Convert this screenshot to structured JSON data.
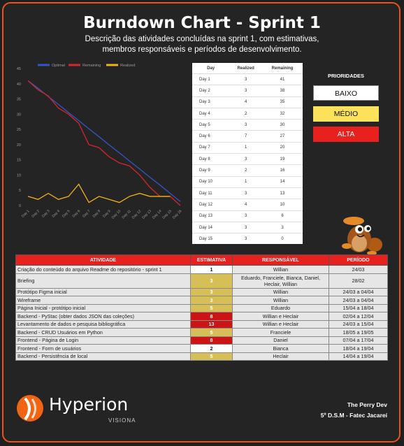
{
  "title": "Burndown Chart - Sprint 1",
  "subtitle_line1": "Descrição das atividades concluídas na sprint 1, com estimativas,",
  "subtitle_line2": "membros responsáveis e períodos de desenvolvimento.",
  "colors": {
    "accent": "#e8541b",
    "optimal": "#3356c6",
    "remaining": "#d7262b",
    "realized": "#f2b21b",
    "priority_low": "#ffffff",
    "priority_mid": "#fbe25a",
    "priority_high": "#e8201e"
  },
  "chart_data": {
    "type": "line",
    "x": [
      "Day 1",
      "Day 2",
      "Day 3",
      "Day 4",
      "Day 5",
      "Day 6",
      "Day 7",
      "Day 8",
      "Day 9",
      "Day 10",
      "Day 11",
      "Day 12",
      "Day 13",
      "Day 14",
      "Day 15",
      "Day 16"
    ],
    "series": [
      {
        "name": "Optimal",
        "values": [
          41,
          38.5,
          35.8,
          33.2,
          30.5,
          27.9,
          25.2,
          22.6,
          19.9,
          17.3,
          14.6,
          12.0,
          9.3,
          6.7,
          4.0,
          1.3
        ]
      },
      {
        "name": "Remaining",
        "values": [
          41,
          38,
          36,
          32,
          30,
          27,
          20,
          19,
          16,
          14,
          13,
          10,
          6,
          3,
          3,
          0
        ]
      },
      {
        "name": "Realized",
        "values": [
          3,
          2,
          4,
          2,
          3,
          7,
          1,
          3,
          2,
          1,
          3,
          4,
          3,
          3,
          3,
          null
        ]
      }
    ],
    "ylim": [
      0,
      45
    ],
    "yticks": [
      0,
      5,
      10,
      15,
      20,
      25,
      30,
      35,
      40,
      45
    ],
    "legend_position": "top",
    "grid": false
  },
  "realized_table": {
    "headers": [
      "Day",
      "Realized",
      "Remaining"
    ],
    "rows": [
      [
        "Day 1",
        "3",
        "41"
      ],
      [
        "Day 2",
        "3",
        "38"
      ],
      [
        "Day 3",
        "4",
        "35"
      ],
      [
        "Day 4",
        "2",
        "32"
      ],
      [
        "Day 5",
        "3",
        "30"
      ],
      [
        "Day 6",
        "7",
        "27"
      ],
      [
        "Day 7",
        "1",
        "20"
      ],
      [
        "Day 8",
        "3",
        "19"
      ],
      [
        "Day 9",
        "2",
        "16"
      ],
      [
        "Day 10",
        "1",
        "14"
      ],
      [
        "Day 11",
        "3",
        "13"
      ],
      [
        "Day 12",
        "4",
        "10"
      ],
      [
        "Day 13",
        "3",
        "6"
      ],
      [
        "Day 14",
        "3",
        "3"
      ],
      [
        "Day 15",
        "3",
        "0"
      ]
    ]
  },
  "priorities": {
    "title": "PRIORIDADES",
    "low": "BAIXO",
    "mid": "MÉDIO",
    "high": "ALTA"
  },
  "activities": {
    "headers": [
      "ATIVIDADE",
      "ESTIMATIVA",
      "RESPONSÁVEL",
      "PERÍODO"
    ],
    "rows": [
      {
        "activity": "Criação do conteúdo do arquivo Readme do repositório - sprint 1",
        "estimate": "1",
        "priority": "low",
        "owner": "Willian",
        "period": "24/03"
      },
      {
        "activity": "Briefing",
        "estimate": "3",
        "priority": "mid",
        "owner": "Eduardo, Franciele, Bianca, Daniel, Heclair, Willian",
        "period": "28/02"
      },
      {
        "activity": "Protótipo Figma inicial",
        "estimate": "3",
        "priority": "mid",
        "owner": "Willian",
        "period": "24/03 a 04/04"
      },
      {
        "activity": "Wireframe",
        "estimate": "3",
        "priority": "mid",
        "owner": "Willian",
        "period": "24/03 a 04/04"
      },
      {
        "activity": "Página Inicial - protótipo inicial",
        "estimate": "5",
        "priority": "mid",
        "owner": "Eduardo",
        "period": "15/04 a 18/04"
      },
      {
        "activity": "Backend - PyStac (obter dados JSON das coleções)",
        "estimate": "8",
        "priority": "high",
        "owner": "Willian e Heclair",
        "period": "02/04 a 12/04"
      },
      {
        "activity": "Levantamento de dados e pesquisa bibliográfica",
        "estimate": "13",
        "priority": "high",
        "owner": "Willian e Heclair",
        "period": "24/03 a 15/04"
      },
      {
        "activity": "Backend - CRUD Usuários em Python",
        "estimate": "5",
        "priority": "mid",
        "owner": "Franciele",
        "period": "18/05 a 19/05"
      },
      {
        "activity": "Frontend - Página de Login",
        "estimate": "8",
        "priority": "high",
        "owner": "Daniel",
        "period": "07/04 a 17/04"
      },
      {
        "activity": "Frontend - Form de usuários",
        "estimate": "2",
        "priority": "low",
        "owner": "Bianca",
        "period": "18/04 a 19/04"
      },
      {
        "activity": "Backend - Persistência de local",
        "estimate": "5",
        "priority": "mid",
        "owner": "Heclair",
        "period": "14/04 a 19/04"
      }
    ]
  },
  "brand": {
    "name": "Hyperion",
    "tagline": "VISIONA"
  },
  "credits": {
    "line1": "The Perry Dev",
    "line2": "5º D.S.M - Fatec Jacareí"
  }
}
